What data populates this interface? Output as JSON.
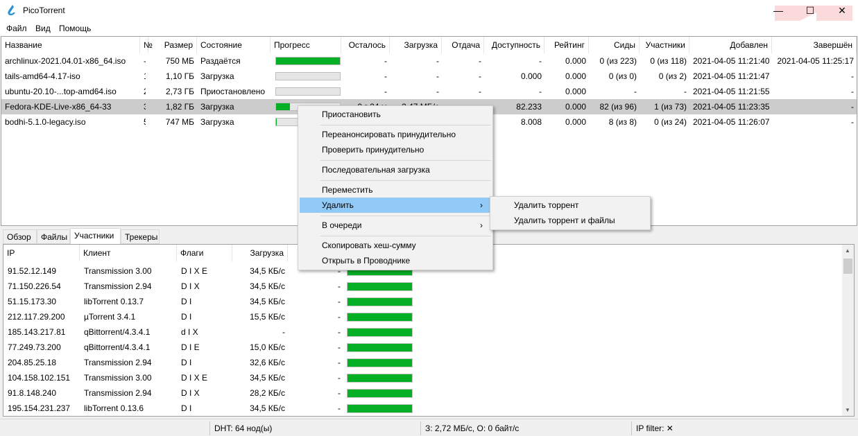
{
  "window": {
    "title": "PicoTorrent",
    "minimize": "—",
    "maximize": "☐",
    "close": "✕"
  },
  "menubar": [
    "Файл",
    "Вид",
    "Помощь"
  ],
  "torrents": {
    "columns": [
      "Название",
      "№",
      "Размер",
      "Состояние",
      "Прогресс",
      "Осталось",
      "Загрузка",
      "Отдача",
      "Доступность",
      "Рейтинг",
      "Сиды",
      "Участники",
      "Добавлен",
      "Завершён"
    ],
    "rows": [
      {
        "name": "archlinux-2021.04.01-x86_64.iso",
        "num": "-",
        "size": "750 МБ",
        "state": "Раздаётся",
        "progress": 100,
        "remaining": "-",
        "down": "-",
        "up": "-",
        "avail": "-",
        "ratio": "0.000",
        "seeds": "0 (из 223)",
        "peers": "0 (из 118)",
        "added": "2021-04-05 11:21:40",
        "done": "2021-04-05 11:25:17"
      },
      {
        "name": "tails-amd64-4.17-iso",
        "num": "1",
        "size": "1,10 ГБ",
        "state": "Загрузка",
        "progress": 0,
        "remaining": "-",
        "down": "-",
        "up": "-",
        "avail": "0.000",
        "ratio": "0.000",
        "seeds": "0 (из 0)",
        "peers": "0 (из 2)",
        "added": "2021-04-05 11:21:47",
        "done": "-"
      },
      {
        "name": "ubuntu-20.10-...top-amd64.iso",
        "num": "2",
        "size": "2,73 ГБ",
        "state": "Приостановлено",
        "progress": 0,
        "remaining": "-",
        "down": "-",
        "up": "-",
        "avail": "-",
        "ratio": "0.000",
        "seeds": "-",
        "peers": "-",
        "added": "2021-04-05 11:21:55",
        "done": "-"
      },
      {
        "name": "Fedora-KDE-Live-x86_64-33",
        "num": "3",
        "size": "1,82 ГБ",
        "state": "Загрузка",
        "progress": 22,
        "remaining": "0 г 24 м",
        "down": "2,47 МБ/с",
        "up": "",
        "avail": "82.233",
        "ratio": "0.000",
        "seeds": "82 (из 96)",
        "peers": "1 (из 73)",
        "added": "2021-04-05 11:23:35",
        "done": "-",
        "selected": true
      },
      {
        "name": "bodhi-5.1.0-legacy.iso",
        "num": "5",
        "size": "747 МБ",
        "state": "Загрузка",
        "progress": 1,
        "remaining": "",
        "down": "",
        "up": "",
        "avail": "8.008",
        "ratio": "0.000",
        "seeds": "8 (из 8)",
        "peers": "0 (из 24)",
        "added": "2021-04-05 11:26:07",
        "done": "-"
      }
    ]
  },
  "tabs": [
    {
      "label": "Обзор"
    },
    {
      "label": "Файлы"
    },
    {
      "label": "Участники",
      "active": true
    },
    {
      "label": "Трекеры"
    }
  ],
  "peers": {
    "columns": [
      "IP",
      "Клиент",
      "Флаги",
      "Загрузка"
    ],
    "rows": [
      {
        "ip": "91.52.12.149",
        "client": "Transmission 3.00",
        "flags": "D I X E",
        "down": "34,5 КБ/с",
        "up": "-",
        "progress": 100
      },
      {
        "ip": "71.150.226.54",
        "client": "Transmission 2.94",
        "flags": "D I X",
        "down": "34,5 КБ/с",
        "up": "-",
        "progress": 100
      },
      {
        "ip": "51.15.173.30",
        "client": "libTorrent 0.13.7",
        "flags": "D I",
        "down": "34,5 КБ/с",
        "up": "-",
        "progress": 100
      },
      {
        "ip": "212.117.29.200",
        "client": "µTorrent 3.4.1",
        "flags": "D I",
        "down": "15,5 КБ/с",
        "up": "-",
        "progress": 100
      },
      {
        "ip": "185.143.217.81",
        "client": "qBittorrent/4.3.4.1",
        "flags": "d I X",
        "down": "-",
        "up": "-",
        "progress": 100
      },
      {
        "ip": "77.249.73.200",
        "client": "qBittorrent/4.3.4.1",
        "flags": "D I E",
        "down": "15,0 КБ/с",
        "up": "-",
        "progress": 100
      },
      {
        "ip": "204.85.25.18",
        "client": "Transmission 2.94",
        "flags": "D I",
        "down": "32,6 КБ/с",
        "up": "-",
        "progress": 100
      },
      {
        "ip": "104.158.102.151",
        "client": "Transmission 3.00",
        "flags": "D I X E",
        "down": "34,5 КБ/с",
        "up": "-",
        "progress": 100
      },
      {
        "ip": "91.8.148.240",
        "client": "Transmission 2.94",
        "flags": "D I X",
        "down": "28,2 КБ/с",
        "up": "-",
        "progress": 100
      },
      {
        "ip": "195.154.231.237",
        "client": "libTorrent 0.13.6",
        "flags": "D I",
        "down": "34,5 КБ/с",
        "up": "-",
        "progress": 100
      }
    ]
  },
  "context_menu": {
    "items": [
      "Приостановить",
      "Переанонсировать принудительно",
      "Проверить принудительно",
      "Последовательная загрузка",
      "Переместить",
      "Удалить",
      "В очереди",
      "Скопировать хеш-сумму",
      "Открыть в Проводнике"
    ],
    "submenu": [
      "Удалить торрент",
      "Удалить торрент и файлы"
    ]
  },
  "status": {
    "dht": "DHT: 64 нод(ы)",
    "speed": "З: 2,72 МБ/с, О: 0 байт/с",
    "ipfilter": "IP filter: ✕"
  },
  "colors": {
    "progress": "#06b025",
    "highlight": "#91c9f7",
    "selected_row": "#cccccc",
    "logo": "#2b8fd8"
  }
}
